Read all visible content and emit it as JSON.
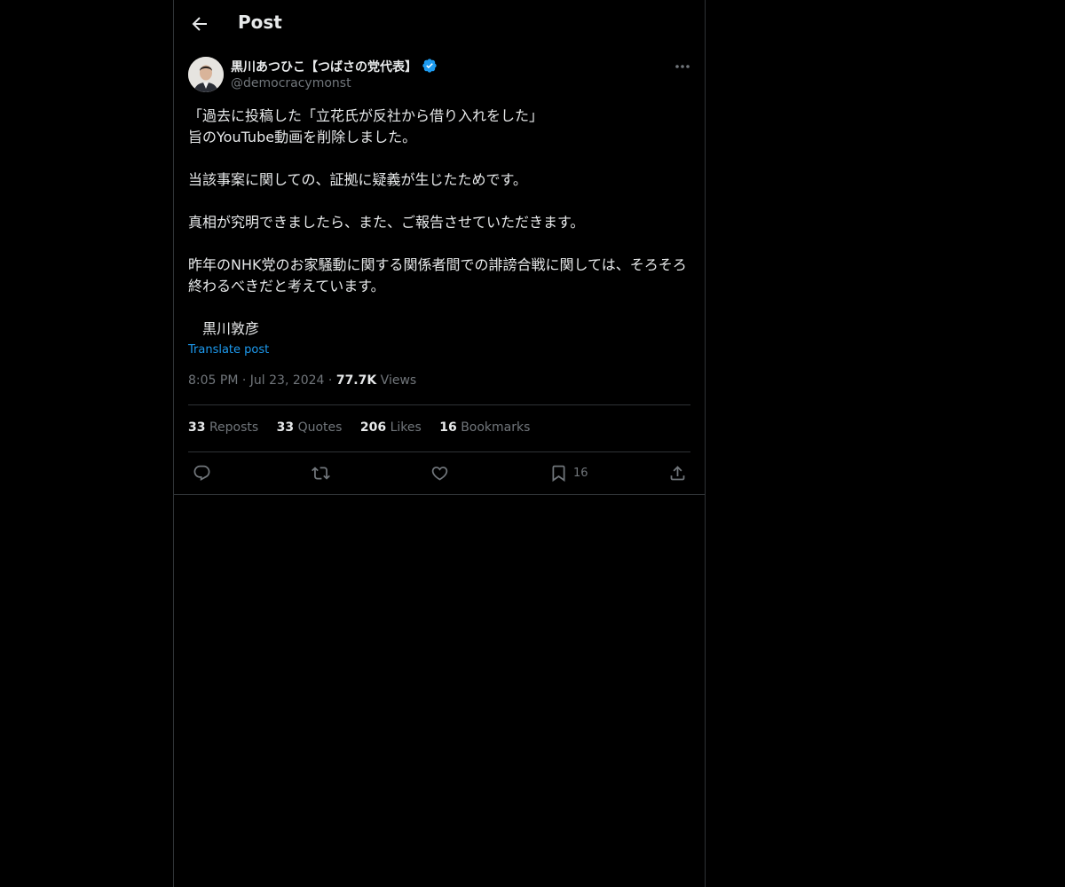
{
  "header": {
    "title": "Post"
  },
  "author": {
    "display_name": "黒川あつひこ【つばさの党代表】",
    "handle": "@democracymonst",
    "verified": true
  },
  "post": {
    "text": "「過去に投稿した「立花氏が反社から借り入れをした」\n旨のYouTube動画を削除しました。\n\n当該事案に関しての、証拠に疑義が生じたためです。\n\n真相が究明できましたら、また、ご報告させていただきます。\n\n昨年のNHK党のお家騒動に関する関係者間での誹謗合戦に関しては、そろそろ終わるべきだと考えています。\n\n　黒川敦彦",
    "translate_label": "Translate post",
    "time": "8:05 PM",
    "date": "Jul 23, 2024",
    "views_count": "77.7K",
    "views_label": "Views"
  },
  "stats": {
    "reposts_count": "33",
    "reposts_label": "Reposts",
    "quotes_count": "33",
    "quotes_label": "Quotes",
    "likes_count": "206",
    "likes_label": "Likes",
    "bookmarks_count": "16",
    "bookmarks_label": "Bookmarks"
  },
  "actions": {
    "bookmark_count": "16"
  },
  "colors": {
    "background": "#000000",
    "text": "#e7e9ea",
    "muted": "#71767b",
    "accent": "#1d9bf0",
    "border": "#2f3336"
  }
}
